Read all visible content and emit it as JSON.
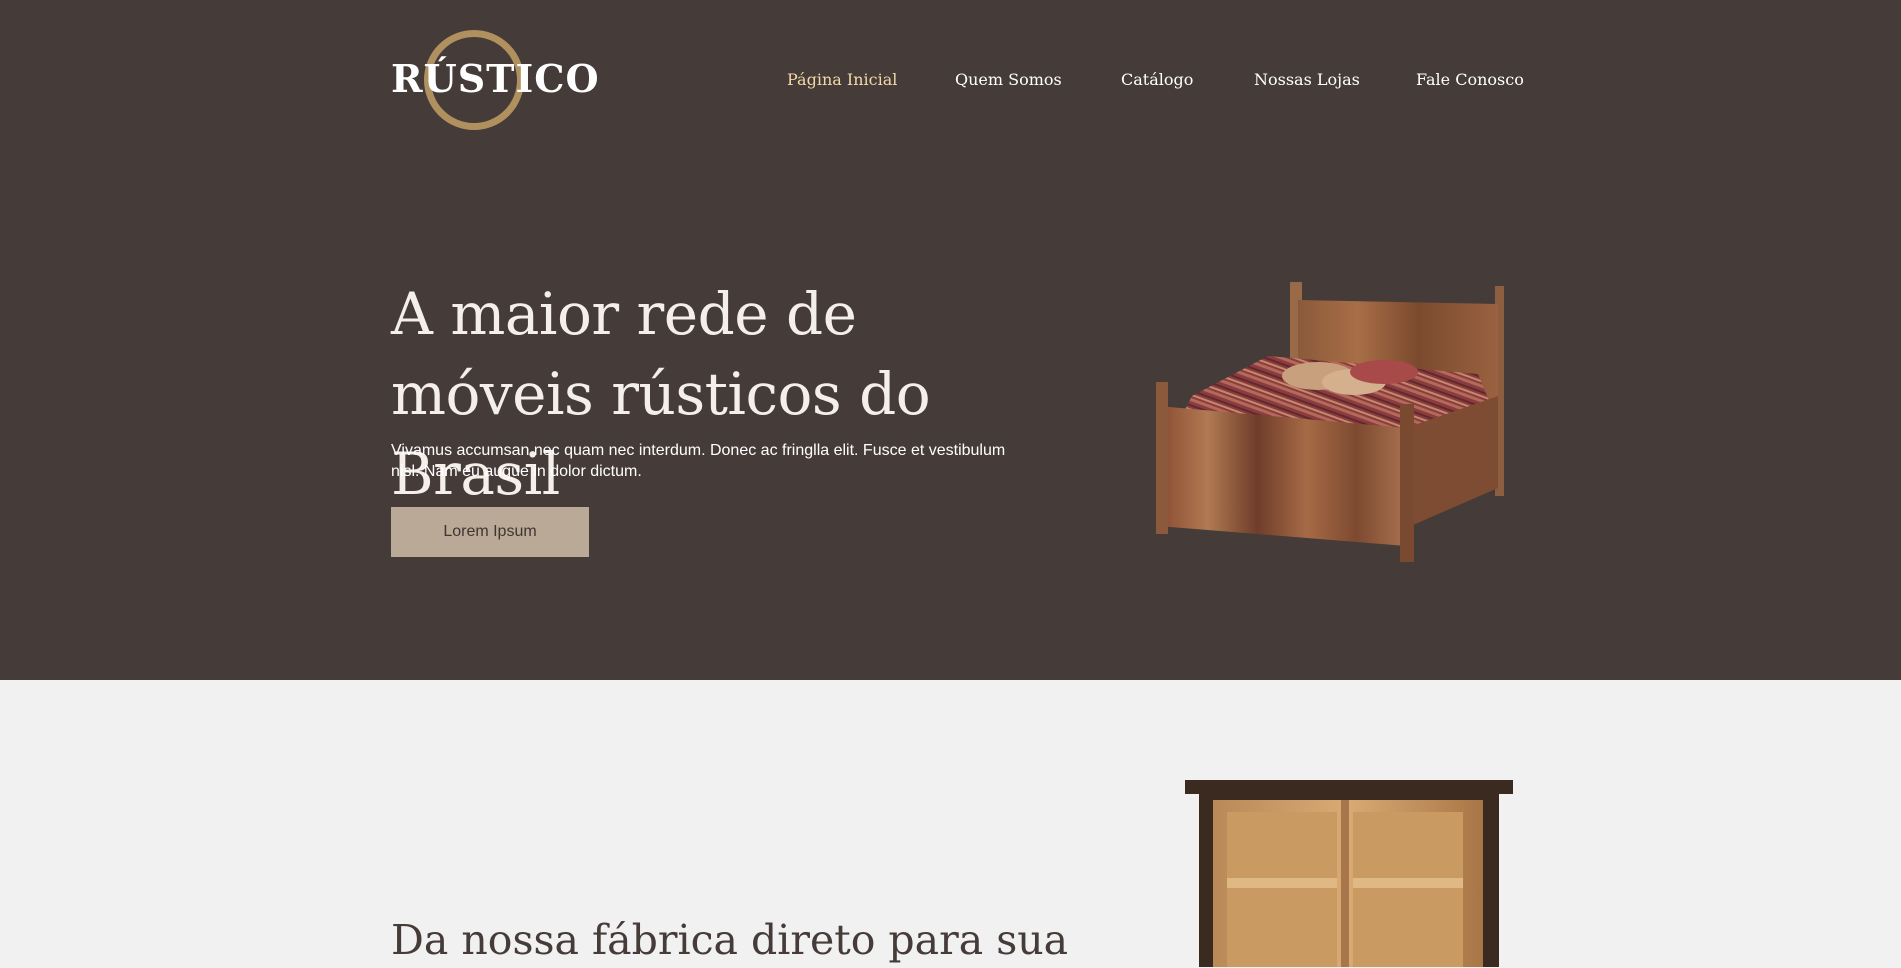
{
  "brand": {
    "logo_text": "RÚSTICO",
    "ring_color": "#b0905f"
  },
  "nav": {
    "items": [
      {
        "label": "Página Inicial",
        "active": true
      },
      {
        "label": "Quem Somos",
        "active": false
      },
      {
        "label": "Catálogo",
        "active": false
      },
      {
        "label": "Nossas Lojas",
        "active": false
      },
      {
        "label": "Fale Conosco",
        "active": false
      }
    ]
  },
  "hero": {
    "title": "A maior rede de móveis rústicos do Brasil",
    "text": "Vivamus accumsan nec quam nec interdum. Donec ac fringlla elit. Fusce et vestibulum nisl. Nam eu augue in dolor dictum.",
    "button_label": "Lorem Ipsum",
    "image": "rustic-bed-photo"
  },
  "section2": {
    "title": "Da nossa fábrica direto para sua",
    "image": "rustic-cabinet-photo"
  },
  "colors": {
    "hero_background": "#453b38",
    "page_background": "#f1f1f1",
    "nav_active": "#f3d9a8",
    "button_background": "#bba998"
  }
}
